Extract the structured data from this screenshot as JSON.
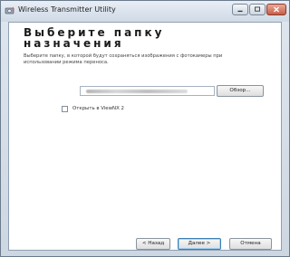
{
  "window": {
    "title": "Wireless Transmitter Utility",
    "controls": {
      "minimize_icon": "minimize-icon",
      "maximize_icon": "maximize-icon",
      "close_icon": "close-icon"
    }
  },
  "page": {
    "heading": "Выберите папку назначения",
    "description": "Выберите папку, в которой будут сохраняться изображения с фотокамеры при использовании режима переноса."
  },
  "folder": {
    "path_value": "",
    "browse_label": "Обзор..."
  },
  "options": {
    "open_in_viewnx_label": "Открыть в ViewNX 2",
    "open_in_viewnx_checked": false
  },
  "footer": {
    "back_label": "< Назад",
    "next_label": "Далее >",
    "cancel_label": "Отмена"
  },
  "colors": {
    "accent": "#3c7fb1",
    "close_button": "#c85c45"
  }
}
